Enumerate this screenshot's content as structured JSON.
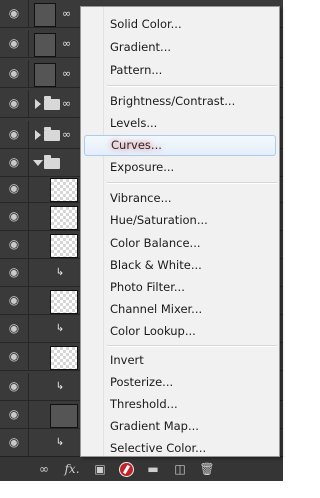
{
  "menu": {
    "groups": [
      [
        "Solid Color...",
        "Gradient...",
        "Pattern..."
      ],
      [
        "Brightness/Contrast...",
        "Levels...",
        "Curves...",
        "Exposure..."
      ],
      [
        "Vibrance...",
        "Hue/Saturation...",
        "Color Balance...",
        "Black & White...",
        "Photo Filter...",
        "Channel Mixer...",
        "Color Lookup..."
      ],
      [
        "Invert",
        "Posterize...",
        "Threshold...",
        "Gradient Map...",
        "Selective Color..."
      ]
    ],
    "items": {
      "solid_color": "Solid Color...",
      "gradient": "Gradient...",
      "pattern": "Pattern...",
      "brightness_contrast": "Brightness/Contrast...",
      "levels": "Levels...",
      "curves": "Curves...",
      "exposure": "Exposure...",
      "vibrance": "Vibrance...",
      "hue_saturation": "Hue/Saturation...",
      "color_balance": "Color Balance...",
      "black_white": "Black & White...",
      "photo_filter": "Photo Filter...",
      "channel_mixer": "Channel Mixer...",
      "color_lookup": "Color Lookup...",
      "invert": "Invert",
      "posterize": "Posterize...",
      "threshold": "Threshold...",
      "gradient_map": "Gradient Map...",
      "selective_color": "Selective Color..."
    },
    "highlighted": "Curves..."
  },
  "footer": {
    "buttons": [
      "link-layers-icon",
      "fx-icon",
      "add-mask-icon",
      "adjustment-layer-icon",
      "new-group-icon",
      "new-layer-icon",
      "delete-icon"
    ],
    "fx_label": "fx."
  },
  "colors": {
    "panel_bg": "#3a3a3a",
    "menu_bg": "#f1f1f1",
    "highlight_border": "#a8cbee",
    "adjustment_red": "#c0242b"
  }
}
